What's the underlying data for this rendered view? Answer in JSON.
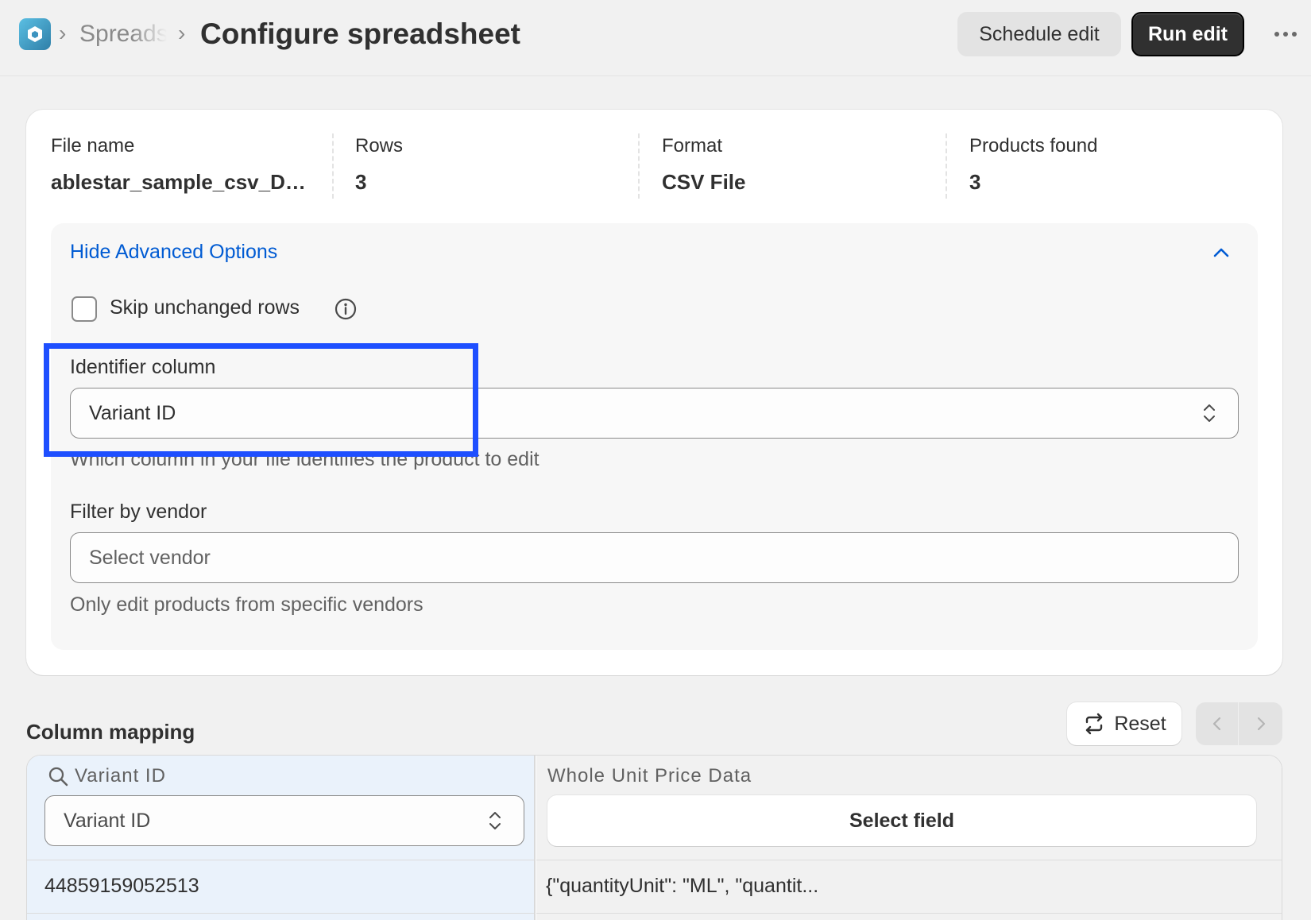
{
  "header": {
    "breadcrumb_parent": "Spreads",
    "title": "Configure spreadsheet",
    "schedule_label": "Schedule edit",
    "run_label": "Run edit",
    "app_icon": "app-hexagon-icon",
    "more_icon": "more-horizontal-icon"
  },
  "summary": {
    "file_name_label": "File name",
    "file_name_value": "ablestar_sample_csv_DA...",
    "rows_label": "Rows",
    "rows_value": "3",
    "format_label": "Format",
    "format_value": "CSV File",
    "products_label": "Products found",
    "products_value": "3"
  },
  "advanced": {
    "toggle_label": "Hide Advanced Options",
    "skip_label": "Skip unchanged rows",
    "skip_checked": false,
    "identifier_label": "Identifier column",
    "identifier_value": "Variant ID",
    "identifier_help": "Which column in your file identifies the product to edit",
    "vendor_label": "Filter by vendor",
    "vendor_placeholder": "Select vendor",
    "vendor_help": "Only edit products from specific vendors"
  },
  "mapping": {
    "title": "Column mapping",
    "reset_label": "Reset",
    "columns": [
      {
        "header": "Variant ID",
        "mapped_value": "Variant ID",
        "cell": "44859159052513"
      },
      {
        "header": "Whole Unit Price Data",
        "mapped_value": "Select field",
        "cell": "{\"quantityUnit\": \"ML\", \"quantit..."
      }
    ]
  },
  "colors": {
    "accent_link": "#005bd3",
    "primary_button": "#303030",
    "highlight_border": "#1e4fff",
    "identifier_column_bg": "#eaf2fb"
  }
}
